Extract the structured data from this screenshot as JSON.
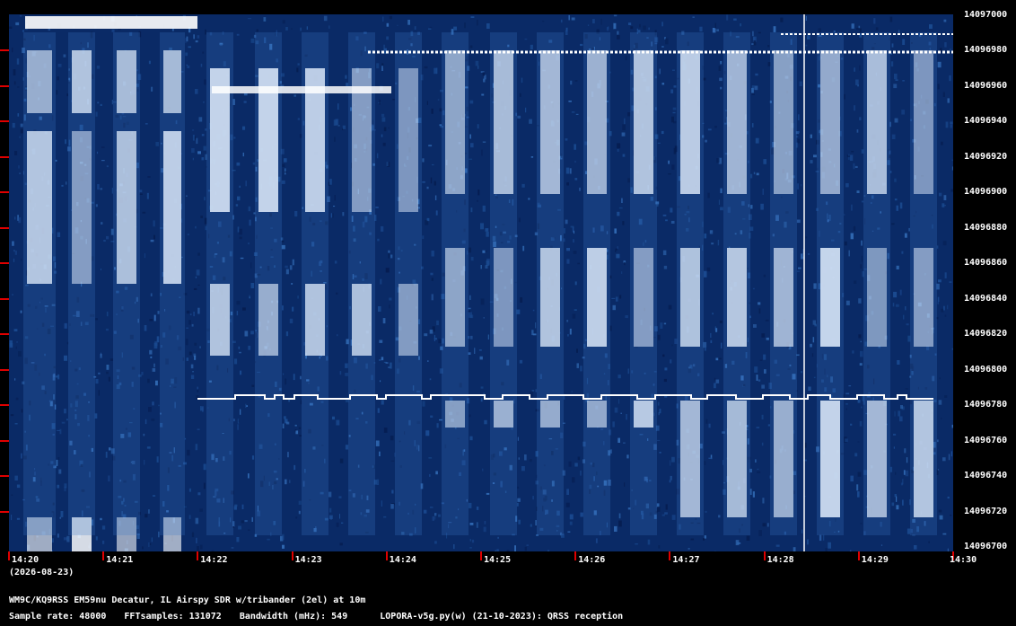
{
  "chart_data": {
    "type": "heatmap",
    "title": "",
    "xlabel": "",
    "ylabel": "",
    "x_tick_labels": [
      "14:20",
      "14:21",
      "14:22",
      "14:23",
      "14:24",
      "14:25",
      "14:26",
      "14:27",
      "14:28",
      "14:29",
      "14:30"
    ],
    "y_tick_labels": [
      "14097000",
      "14096980",
      "14096960",
      "14096940",
      "14096920",
      "14096900",
      "14096880",
      "14096860",
      "14096840",
      "14096820",
      "14096800",
      "14096780",
      "14096760",
      "14096740",
      "14096720",
      "14096700"
    ],
    "xlim": [
      "14:20",
      "14:30"
    ],
    "ylim": [
      14096700,
      14097000
    ],
    "date_label": "(2026-08-23)",
    "colors": {
      "background": "#0a2a66",
      "signal": "#ffffff",
      "tick": "#e00000"
    }
  },
  "info": {
    "line1": "WM9C/KQ9RSS EM59nu Decatur, IL  Airspy SDR w/tribander (2el) at 10m",
    "sample_rate": "Sample rate: 48000",
    "fft_samples": "FFTsamples: 131072",
    "bandwidth": "Bandwidth (mHz): 549",
    "software": "LOPORA-v5g.py(w) (21-10-2023): QRSS reception"
  }
}
